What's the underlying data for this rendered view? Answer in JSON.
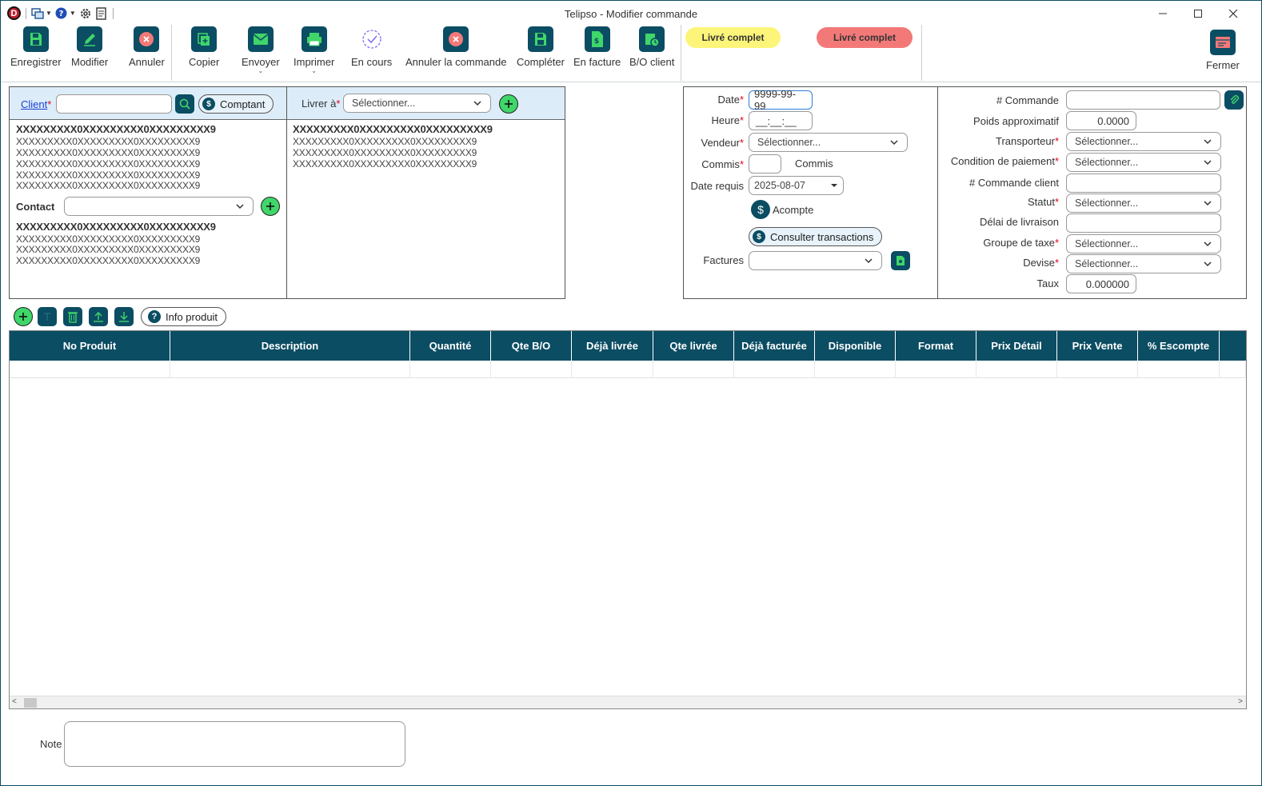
{
  "window": {
    "title": "Telipso - Modifier commande",
    "app_logo": "D"
  },
  "toolbar": {
    "save": "Enregistrer",
    "edit": "Modifier",
    "cancel": "Annuler",
    "copy": "Copier",
    "send": "Envoyer",
    "print": "Imprimer",
    "in_progress": "En cours",
    "cancel_order": "Annuler la commande",
    "complete": "Compléter",
    "to_invoice": "En facture",
    "bo_client": "B/O client",
    "status_yellow": "Livré complet",
    "status_red": "Livré complet",
    "close": "Fermer",
    "colors": {
      "icon_bg": "#0b4d63",
      "yellow": "#fdf57a",
      "red": "#f37979",
      "green": "#3fd66a"
    }
  },
  "client_panel": {
    "client_label": "Client",
    "client_value": "",
    "cash_button": "Comptant",
    "address_bold": "XXXXXXXXX0XXXXXXXXX0XXXXXXXXX9",
    "address_lines": [
      "XXXXXXXXX0XXXXXXXXX0XXXXXXXXX9",
      "XXXXXXXXX0XXXXXXXXX0XXXXXXXXX9",
      "XXXXXXXXX0XXXXXXXXX0XXXXXXXXX9",
      "XXXXXXXXX0XXXXXXXXX0XXXXXXXXX9",
      "XXXXXXXXX0XXXXXXXXX0XXXXXXXXX9"
    ],
    "contact_label": "Contact",
    "contact_value": "",
    "contact_bold": "XXXXXXXXX0XXXXXXXXX0XXXXXXXXX9",
    "contact_lines": [
      "XXXXXXXXX0XXXXXXXXX0XXXXXXXXX9",
      "XXXXXXXXX0XXXXXXXXX0XXXXXXXXX9",
      "XXXXXXXXX0XXXXXXXXX0XXXXXXXXX9"
    ]
  },
  "ship_panel": {
    "ship_label": "Livrer à",
    "ship_select": "Sélectionner...",
    "address_bold": "XXXXXXXXX0XXXXXXXXX0XXXXXXXXX9",
    "address_lines": [
      "XXXXXXXXX0XXXXXXXXX0XXXXXXXXX9",
      "XXXXXXXXX0XXXXXXXXX0XXXXXXXXX9",
      "XXXXXXXXX0XXXXXXXXX0XXXXXXXXX9"
    ]
  },
  "order_panel": {
    "date_label": "Date",
    "date_value": "9999-99-99",
    "time_label": "Heure",
    "time_value": "__:__:__",
    "seller_label": "Vendeur",
    "seller_value": "Sélectionner...",
    "commis_label": "Commis",
    "commis_value": "",
    "commis_text": "Commis",
    "date_req_label": "Date requis",
    "date_req_value": "2025-08-07",
    "deposit": "Acompte",
    "transactions": "Consulter transactions",
    "invoices_label": "Factures",
    "invoices_value": ""
  },
  "detail_panel": {
    "order_no_label": "# Commande",
    "order_no_value": "",
    "weight_label": "Poids approximatif",
    "weight_value": "0.0000",
    "carrier_label": "Transporteur",
    "carrier_value": "Sélectionner...",
    "payment_label": "Condition de paiement",
    "payment_value": "Sélectionner...",
    "client_order_label": "# Commande client",
    "client_order_value": "",
    "status_label": "Statut",
    "status_value": "Sélectionner...",
    "delay_label": "Délai de livraison",
    "delay_value": "",
    "tax_label": "Groupe de taxe",
    "tax_value": "Sélectionner...",
    "currency_label": "Devise",
    "currency_value": "Sélectionner...",
    "rate_label": "Taux",
    "rate_value": "0.000000"
  },
  "grid_toolbar": {
    "info_product": "Info produit"
  },
  "grid": {
    "columns": [
      "No Produit",
      "Description",
      "Quantité",
      "Qte B/O",
      "Déjà livrée",
      "Qte livrée",
      "Déjà facturée",
      "Disponible",
      "Format",
      "Prix Détail",
      "Prix Vente",
      "% Escompte"
    ]
  },
  "note": {
    "label": "Note",
    "value": ""
  }
}
